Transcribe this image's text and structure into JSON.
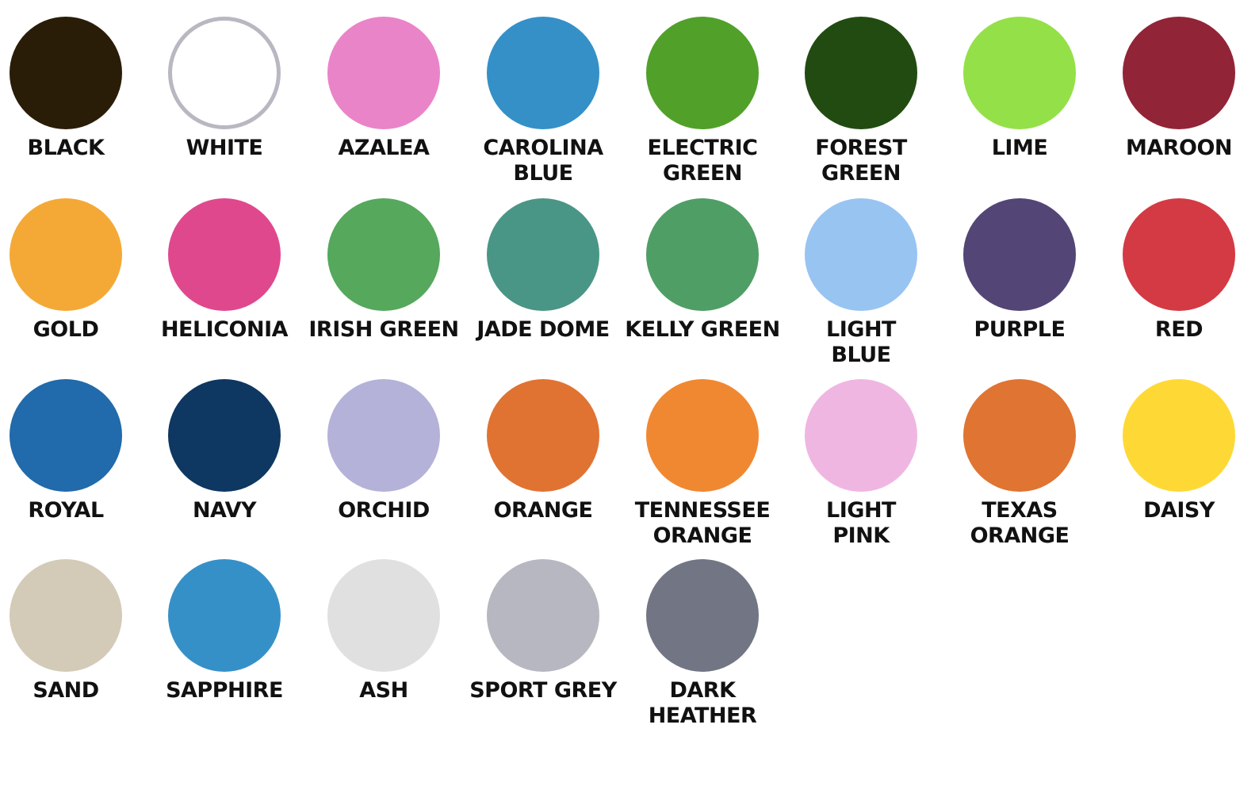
{
  "swatches": [
    {
      "lines": [
        "BLACK"
      ],
      "color": "#2a1d08"
    },
    {
      "lines": [
        "WHITE"
      ],
      "color": "#ffffff",
      "outlined": true
    },
    {
      "lines": [
        "AZALEA"
      ],
      "color": "#ea84c8"
    },
    {
      "lines": [
        "CAROLINA",
        "BLUE"
      ],
      "color": "#3590c8"
    },
    {
      "lines": [
        "ELECTRIC",
        "GREEN"
      ],
      "color": "#51a02a"
    },
    {
      "lines": [
        "FOREST",
        "GREEN"
      ],
      "color": "#224b12"
    },
    {
      "lines": [
        "LIME"
      ],
      "color": "#94e048"
    },
    {
      "lines": [
        "MAROON"
      ],
      "color": "#922438"
    },
    {
      "lines": [
        "GOLD"
      ],
      "color": "#f4a936"
    },
    {
      "lines": [
        "HELICONIA"
      ],
      "color": "#e0488e"
    },
    {
      "lines": [
        "IRISH GREEN"
      ],
      "color": "#55a85c"
    },
    {
      "lines": [
        "JADE DOME"
      ],
      "color": "#4a9686"
    },
    {
      "lines": [
        "KELLY GREEN"
      ],
      "color": "#4f9e66"
    },
    {
      "lines": [
        "LIGHT",
        "BLUE"
      ],
      "color": "#98c4f2"
    },
    {
      "lines": [
        "PURPLE"
      ],
      "color": "#534576"
    },
    {
      "lines": [
        "RED"
      ],
      "color": "#d43a44"
    },
    {
      "lines": [
        "ROYAL"
      ],
      "color": "#216aab"
    },
    {
      "lines": [
        "NAVY"
      ],
      "color": "#0e3762"
    },
    {
      "lines": [
        "ORCHID"
      ],
      "color": "#b4b2d8"
    },
    {
      "lines": [
        "ORANGE"
      ],
      "color": "#e07332"
    },
    {
      "lines": [
        "TENNESSEE",
        "ORANGE"
      ],
      "color": "#f08832"
    },
    {
      "lines": [
        "LIGHT",
        "PINK"
      ],
      "color": "#f0b6e2"
    },
    {
      "lines": [
        "TEXAS",
        "ORANGE"
      ],
      "color": "#e07432"
    },
    {
      "lines": [
        "DAISY"
      ],
      "color": "#fed936"
    },
    {
      "lines": [
        "SAND"
      ],
      "color": "#d3cbb8"
    },
    {
      "lines": [
        "SAPPHIRE"
      ],
      "color": "#3690c8"
    },
    {
      "lines": [
        "ASH"
      ],
      "color": "#e0e0e0"
    },
    {
      "lines": [
        "SPORT GREY"
      ],
      "color": "#b6b7c0"
    },
    {
      "lines": [
        "DARK",
        "HEATHER"
      ],
      "color": "#727584"
    }
  ]
}
